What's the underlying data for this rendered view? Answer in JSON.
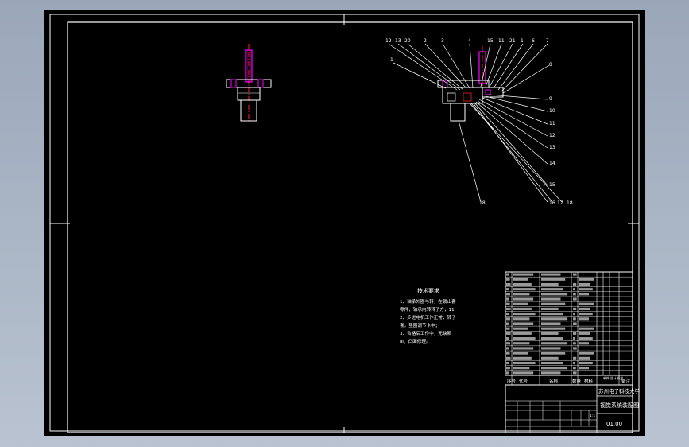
{
  "technical_requirements": {
    "heading": "技术要求",
    "lines": [
      "1、轴承外圈与转，在锁止套",
      "   零件，轴承内转转子方，11",
      "2、步进电机工作正常，转子",
      "   套，垫圈调节卡中；",
      "3、合格后工作中，无缺陷",
      "   III、凸面修理。"
    ]
  },
  "leaders": {
    "top": [
      "12",
      "13",
      "20",
      "2",
      "3",
      "4",
      "15",
      "11",
      "21",
      "1",
      "6",
      "7"
    ],
    "left": "1",
    "right": [
      "8",
      "9",
      "10",
      "11",
      "12",
      "13",
      "14",
      "15",
      "16",
      "17",
      "18"
    ],
    "bottom": "18"
  },
  "title_block": {
    "university": "苏州电子科技大学",
    "drawing_name": "视觉系统装配图",
    "drawing_no": "01.00",
    "headers": [
      "序号",
      "代号",
      "名称",
      "数量",
      "材料",
      "单件 总计 质量",
      "备注"
    ],
    "scale": "1:1"
  },
  "colors": {
    "background": "#000000",
    "frame": "#ffffff",
    "part_outline": "#ffffff",
    "centerline": "#ff2020",
    "screw_magenta": "#ff00ff",
    "leader": "#ffffff"
  }
}
